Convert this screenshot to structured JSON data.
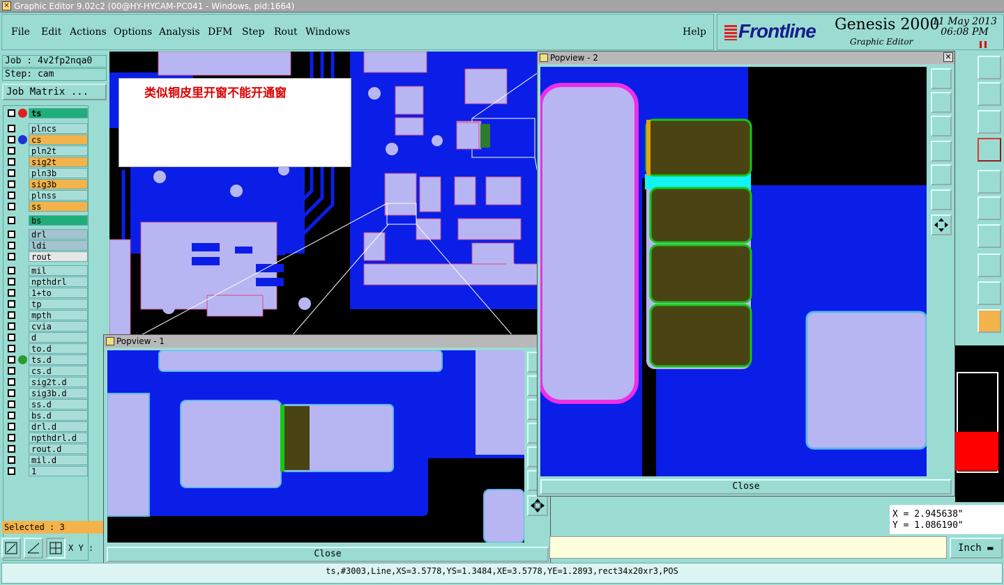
{
  "window": {
    "title": "Graphic Editor 9.02c2 (00@HY-HYCAM-PC041 - Windows, pid:1664)"
  },
  "menu": {
    "file": "File",
    "edit": "Edit",
    "actions": "Actions",
    "options": "Options",
    "analysis": "Analysis",
    "dfm": "DFM",
    "step": "Step",
    "rout": "Rout",
    "windows": "Windows",
    "help": "Help"
  },
  "brand": {
    "logo": "Frontline",
    "product": "Genesis 2000",
    "subtitle": "Graphic Editor",
    "date": "11 May 2013",
    "time": "06:08 PM"
  },
  "job": {
    "job_line": "Job : 4v2fp2nqa0",
    "step_line": "Step: cam",
    "matrix_button": "Job Matrix ..."
  },
  "layers": [
    {
      "name": "ts",
      "color": "#1fae7a",
      "dot": "#e02020",
      "bold": true
    },
    {
      "name": "plncs",
      "color": "#a9ded8"
    },
    {
      "name": "cs",
      "color": "#f3b34a",
      "dot": "#1b33d6"
    },
    {
      "name": "pln2t",
      "color": "#a9ded8"
    },
    {
      "name": "sig2t",
      "color": "#f3b34a"
    },
    {
      "name": "pln3b",
      "color": "#a9ded8"
    },
    {
      "name": "sig3b",
      "color": "#f3b34a"
    },
    {
      "name": "plnss",
      "color": "#a9ded8"
    },
    {
      "name": "ss",
      "color": "#f3b34a"
    },
    {
      "name": "bs",
      "color": "#1fae7a"
    },
    {
      "name": "drl",
      "color": "#a3c4cf"
    },
    {
      "name": "ldi",
      "color": "#a3c4cf"
    },
    {
      "name": "rout",
      "color": "#e6e6e6"
    },
    {
      "name": "mil",
      "color": "#a9ded8"
    },
    {
      "name": "npthdrl",
      "color": "#a9ded8"
    },
    {
      "name": "1+to",
      "color": "#a9ded8"
    },
    {
      "name": "tp",
      "color": "#a9ded8"
    },
    {
      "name": "mpth",
      "color": "#a9ded8"
    },
    {
      "name": "cvia",
      "color": "#a9ded8"
    },
    {
      "name": "d",
      "color": "#a9ded8"
    },
    {
      "name": "to.d",
      "color": "#a9ded8"
    },
    {
      "name": "ts.d",
      "color": "#a9ded8",
      "dot": "#2e9a2e"
    },
    {
      "name": "cs.d",
      "color": "#a9ded8"
    },
    {
      "name": "sig2t.d",
      "color": "#a9ded8"
    },
    {
      "name": "sig3b.d",
      "color": "#a9ded8"
    },
    {
      "name": "ss.d",
      "color": "#a9ded8"
    },
    {
      "name": "bs.d",
      "color": "#a9ded8"
    },
    {
      "name": "drl.d",
      "color": "#a9ded8"
    },
    {
      "name": "npthdrl.d",
      "color": "#a9ded8"
    },
    {
      "name": "rout.d",
      "color": "#a9ded8"
    },
    {
      "name": "mil.d",
      "color": "#a9ded8"
    },
    {
      "name": "1",
      "color": "#a9ded8"
    }
  ],
  "selected": "Selected : 3",
  "xy_label": "X Y :",
  "annotation": "类似铜皮里开窗不能开通窗",
  "popview1": {
    "title": "Popview - 1",
    "close": "Close"
  },
  "popview2": {
    "title": "Popview - 2",
    "close": "Close"
  },
  "coords": {
    "x": "X = 2.945638\"",
    "y": "Y = 1.086190\""
  },
  "units": "Inch",
  "status": "ts,#3003,Line,XS=3.5778,YS=1.3484,XE=3.5778,YE=1.2893,rect34x20xr3,POS",
  "colors": {
    "copper": "#0a1ee8",
    "pad": "#b8b6f2",
    "window": "#4a4414",
    "app": "#9bdcd2"
  }
}
